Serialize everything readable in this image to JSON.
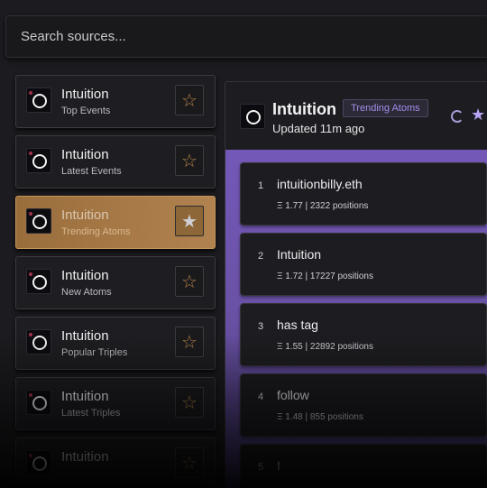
{
  "search": {
    "placeholder": "Search sources..."
  },
  "sources": [
    {
      "title": "Intuition",
      "subtitle": "Top Events",
      "active": false
    },
    {
      "title": "Intuition",
      "subtitle": "Latest Events",
      "active": false
    },
    {
      "title": "Intuition",
      "subtitle": "Trending Atoms",
      "active": true
    },
    {
      "title": "Intuition",
      "subtitle": "New Atoms",
      "active": false
    },
    {
      "title": "Intuition",
      "subtitle": "Popular Triples",
      "active": false
    },
    {
      "title": "Intuition",
      "subtitle": "Latest Triples",
      "active": false
    },
    {
      "title": "Intuition",
      "subtitle": "",
      "active": false
    }
  ],
  "panel": {
    "title": "Intuition",
    "tag": "Trending Atoms",
    "updated": "Updated 11m ago",
    "icons": [
      "refresh-icon",
      "star-icon"
    ]
  },
  "atoms": [
    {
      "rank": "1",
      "name": "intuitionbilly.eth",
      "meta": "Ξ 1.77 | 2322 positions"
    },
    {
      "rank": "2",
      "name": "Intuition",
      "meta": "Ξ 1.72 | 17227 positions"
    },
    {
      "rank": "3",
      "name": "has tag",
      "meta": "Ξ 1.55 | 22892 positions"
    },
    {
      "rank": "4",
      "name": "follow",
      "meta": "Ξ 1.48 | 855 positions"
    },
    {
      "rank": "5",
      "name": "I",
      "meta": ""
    }
  ],
  "colors": {
    "accent_active": "#b08250",
    "star": "#b58246",
    "purple": "#7458b8"
  }
}
